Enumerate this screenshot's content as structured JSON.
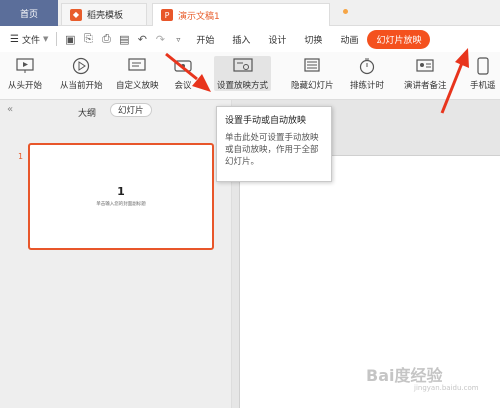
{
  "tabs": {
    "home": "首页",
    "template": "稻壳模板",
    "document": "演示文稿1"
  },
  "menu": {
    "file": "文件",
    "items": [
      "开始",
      "插入",
      "设计",
      "切换",
      "动画"
    ],
    "active_item": "幻灯片放映"
  },
  "ribbon": {
    "buttons": [
      "从头开始",
      "从当前开始",
      "自定义放映",
      "会议",
      "设置放映方式",
      "隐藏幻灯片",
      "排练计时",
      "演讲者备注",
      "手机遥"
    ]
  },
  "left_panel": {
    "outline_tab": "大纲",
    "slides_tab": "幻灯片",
    "collapse_glyph": "«",
    "slide_number": "1",
    "thumb_title": "1",
    "thumb_subtitle": "单击输入您的封面副标题"
  },
  "tooltip": {
    "title": "设置手动或自动放映",
    "body": "单击此处可设置手动放映或自动放映，作用于全部幻灯片。"
  },
  "watermark": {
    "text": "Bai度经验",
    "sub": "jingyan.baidu.com"
  },
  "colors": {
    "accent": "#f4511e",
    "home_tab": "#5b6e9a",
    "annotation_arrow": "#e8341c"
  }
}
